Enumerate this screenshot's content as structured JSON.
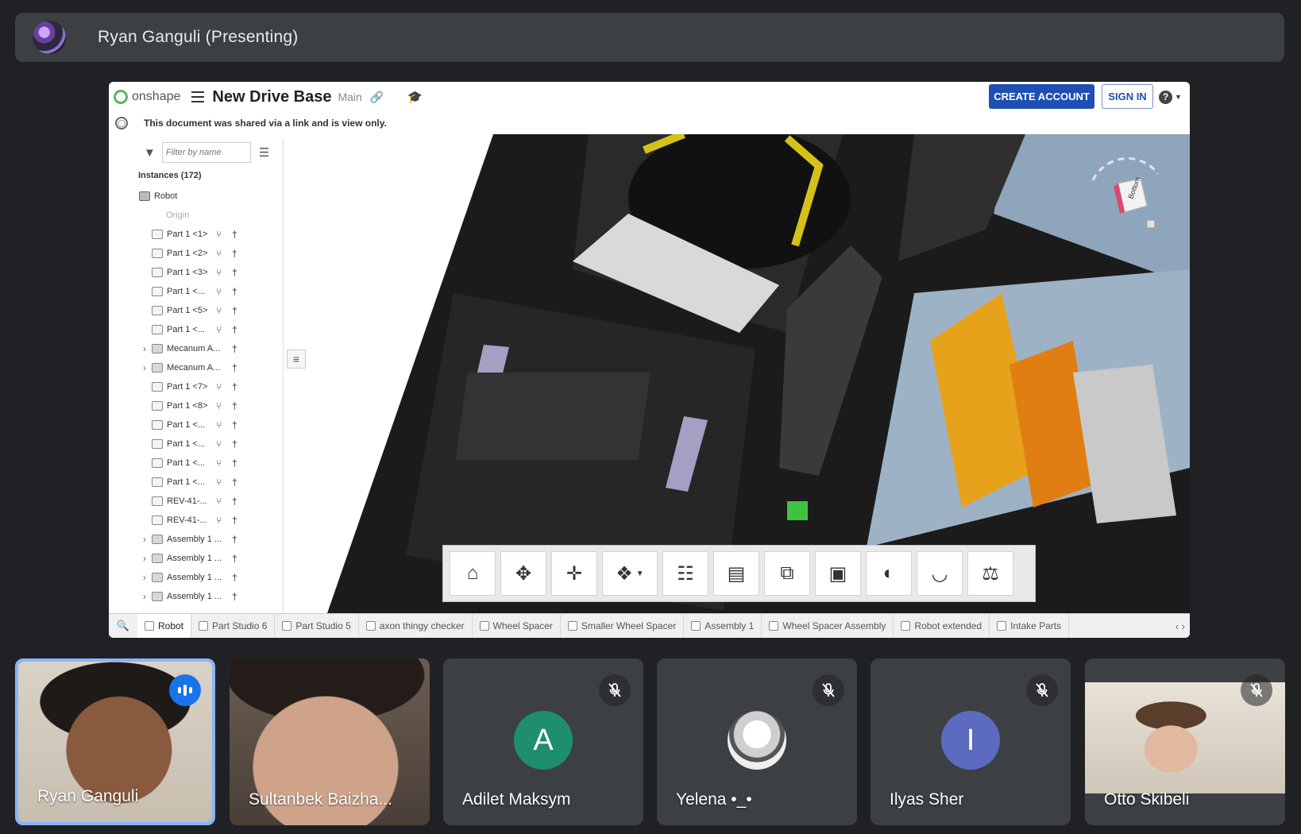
{
  "presenter": {
    "name": "Ryan Ganguli (Presenting)"
  },
  "onshape": {
    "logo": "onshape",
    "doc_title": "New Drive Base",
    "branch": "Main",
    "create_account": "CREATE ACCOUNT",
    "sign_in": "SIGN IN",
    "help": "?",
    "notice": "This document was shared via a link and is view only.",
    "filter_placeholder": "Filter by name",
    "instances_label": "Instances (172)",
    "tree": [
      {
        "label": "Robot",
        "kind": "root"
      },
      {
        "label": "Origin",
        "kind": "origin"
      },
      {
        "label": "Part 1 <1>",
        "kind": "part"
      },
      {
        "label": "Part 1 <2>",
        "kind": "part"
      },
      {
        "label": "Part 1 <3>",
        "kind": "part"
      },
      {
        "label": "Part 1 <...",
        "kind": "part"
      },
      {
        "label": "Part 1 <5>",
        "kind": "part"
      },
      {
        "label": "Part 1 <...",
        "kind": "part"
      },
      {
        "label": "Mecanum A...",
        "kind": "asm"
      },
      {
        "label": "Mecanum A...",
        "kind": "asm"
      },
      {
        "label": "Part 1 <7>",
        "kind": "part"
      },
      {
        "label": "Part 1 <8>",
        "kind": "part"
      },
      {
        "label": "Part 1 <...",
        "kind": "part"
      },
      {
        "label": "Part 1 <...",
        "kind": "part"
      },
      {
        "label": "Part 1 <...",
        "kind": "part"
      },
      {
        "label": "Part 1 <...",
        "kind": "part"
      },
      {
        "label": "REV-41-...",
        "kind": "part"
      },
      {
        "label": "REV-41-...",
        "kind": "part"
      },
      {
        "label": "Assembly 1 ...",
        "kind": "asm"
      },
      {
        "label": "Assembly 1 ...",
        "kind": "asm"
      },
      {
        "label": "Assembly 1 ...",
        "kind": "asm"
      },
      {
        "label": "Assembly 1 ...",
        "kind": "asm"
      }
    ],
    "viewcube_face": "Bottom",
    "tabs": [
      {
        "label": "Robot",
        "active": true
      },
      {
        "label": "Part Studio 6",
        "active": false
      },
      {
        "label": "Part Studio 5",
        "active": false
      },
      {
        "label": "axon thingy checker",
        "active": false
      },
      {
        "label": "Wheel Spacer",
        "active": false
      },
      {
        "label": "Smaller Wheel Spacer",
        "active": false
      },
      {
        "label": "Assembly 1",
        "active": false
      },
      {
        "label": "Wheel Spacer Assembly",
        "active": false
      },
      {
        "label": "Robot extended",
        "active": false
      },
      {
        "label": "Intake Parts",
        "active": false
      }
    ],
    "toolbar_icons": [
      "home-icon",
      "rotate-icon",
      "pan-icon",
      "zoom-icon",
      "section-icon",
      "list-icon",
      "mate-icon",
      "measure-box-icon",
      "tape-icon",
      "gauge-icon",
      "balance-icon"
    ]
  },
  "participants": [
    {
      "name": "Ryan Ganguli",
      "state": "speaking",
      "video": true
    },
    {
      "name": "Sultanbek Baizha...",
      "state": "none",
      "video": true
    },
    {
      "name": "Adilet Maksym",
      "state": "muted",
      "initial": "A",
      "color": "#1e8e6e"
    },
    {
      "name": "Yelena •_•",
      "state": "muted",
      "avatar": true
    },
    {
      "name": "Ilyas Sher",
      "state": "muted",
      "initial": "I",
      "color": "#5c6bc0"
    },
    {
      "name": "Otto Skibeli",
      "state": "muted",
      "video": true
    }
  ]
}
